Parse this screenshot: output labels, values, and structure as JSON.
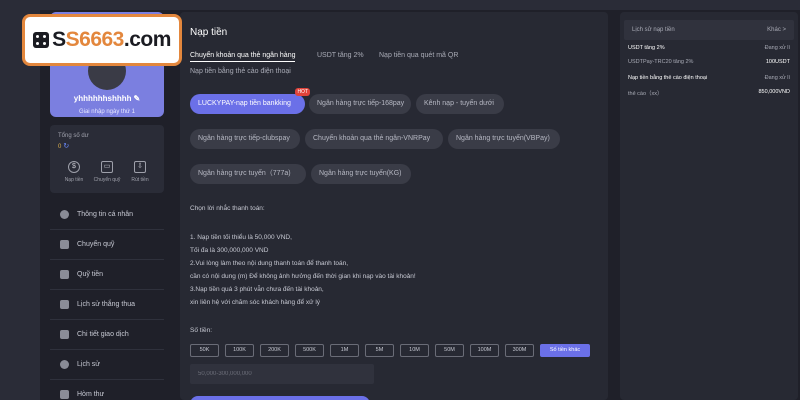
{
  "logo": {
    "prefix": "S",
    "middle": "S",
    "brand": "6663",
    "suffix": ".com"
  },
  "profile": {
    "username": "yhhhhhhshhhh",
    "login_day": "Giai nhập ngày thứ 1"
  },
  "balance": {
    "label": "Tổng số dư",
    "value": "0"
  },
  "quick_actions": [
    {
      "label": "Nạp tiền",
      "icon": "deposit-icon"
    },
    {
      "label": "Chuyển quỹ",
      "icon": "wallet-icon"
    },
    {
      "label": "Rút tiền",
      "icon": "withdraw-icon"
    }
  ],
  "menu": [
    {
      "label": "Thông tin cá nhân",
      "icon": "user-icon"
    },
    {
      "label": "Chuyển quỹ",
      "icon": "transfer-icon"
    },
    {
      "label": "Quỹ tiền",
      "icon": "fund-icon"
    },
    {
      "label": "Lịch sử thắng thua",
      "icon": "history-icon"
    },
    {
      "label": "Chi tiết giao dịch",
      "icon": "transaction-icon"
    },
    {
      "label": "Lịch sử",
      "icon": "clock-icon"
    },
    {
      "label": "Hòm thư",
      "icon": "mail-icon"
    }
  ],
  "main": {
    "title": "Nạp tiền",
    "tabs": [
      "Chuyển khoản qua thẻ ngân hàng",
      "USDT tăng 2%",
      "Nạp tiền qua quét mã QR",
      "Nạp tiền bằng thẻ cào điện thoại"
    ],
    "channels": [
      {
        "label": "LUCKYPAY-nạp tiền bankking",
        "hot": "HOT"
      },
      {
        "label": "Ngân hàng trực tiếp-168pay"
      },
      {
        "label": "Kênh nạp - tuyến dưới"
      },
      {
        "label": "Ngân hàng trực tiếp-clubspay"
      },
      {
        "label": "Chuyển khoản qua thẻ ngân-VNRPay"
      },
      {
        "label": "Ngân hàng trực tuyến(VBPay)"
      },
      {
        "label": "Ngân hàng trực tuyến（777a)"
      },
      {
        "label": "Ngân hàng trực tuyến(KG)"
      }
    ],
    "reminder_title": "Chọn lời nhắc thanh toán:",
    "reminders": [
      "1. Nạp tiền tối thiểu là 50,000 VND,",
      "Tối đa là 300,000,000 VND",
      "2.Vui lòng làm theo nội dung thanh toán để thanh toán,",
      "cần có nội dung (m) Để không ảnh hưởng đến thời gian khi nạp  vào tài khoản!",
      "3.Nạp tiền quá 3 phút vẫn chưa đến tài khoản,",
      "xin liên hệ với chăm sóc khách hàng để xử lý"
    ],
    "amount_label": "Số tiền:",
    "amounts": [
      "50K",
      "100K",
      "200K",
      "500K",
      "1M",
      "5M",
      "10M",
      "50M",
      "100M",
      "300M"
    ],
    "other_amount": "Số tiền khác",
    "amount_placeholder": "50,000-300,000,000"
  },
  "right": {
    "header": "Lịch sử nạp tiền",
    "more": "Khác >",
    "records": [
      {
        "title": "USDT tăng 2%",
        "status": "Đang xử lí",
        "sub": "USDTPay-TRC20 tăng 2%",
        "amount": "100USDT"
      },
      {
        "title": "Nạp tiền bằng thẻ cào điện thoại",
        "status": "Đang xử lí",
        "sub": "thẻ cào（xx）",
        "amount": "850,000VND"
      }
    ]
  }
}
